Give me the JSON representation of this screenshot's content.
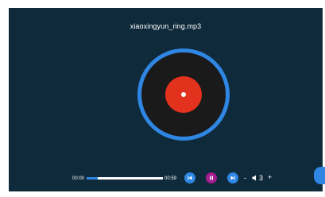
{
  "player": {
    "title": "xiaoxingyun_ring.mp3",
    "current_time": "00:00",
    "total_time": "00:59",
    "progress": 0.15,
    "volume": {
      "minus_label": "-",
      "value": "3",
      "plus_label": "+"
    },
    "icons": {
      "prev": "skip-previous-icon",
      "pause": "pause-icon",
      "next": "skip-next-icon",
      "volume": "speaker-icon"
    },
    "colors": {
      "background": "#0f2a3a",
      "accent": "#2f86e3",
      "disc_label": "#e2311c",
      "pause_button": "#a41c8f"
    }
  }
}
